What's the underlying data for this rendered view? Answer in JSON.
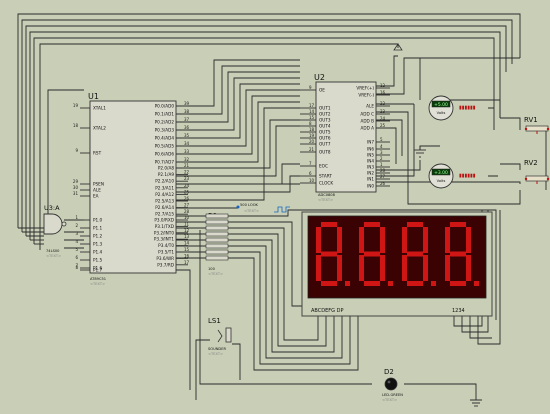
{
  "u1": {
    "ref": "U1",
    "part": "AT89C51",
    "text_hint": "<TEXT>",
    "left_pins": [
      "XTAL1",
      "XTAL2",
      "RST",
      "PSEN",
      "ALE",
      "EA",
      "P1.0",
      "P1.1",
      "P1.2",
      "P1.3",
      "P1.4",
      "P1.5",
      "P1.6",
      "P1.7"
    ],
    "left_pin_nums": [
      "19",
      "18",
      "9",
      "29",
      "30",
      "31",
      "1",
      "2",
      "3",
      "4",
      "5",
      "6",
      "7",
      "8"
    ],
    "right_pins": [
      "P0.0/AD0",
      "P0.1/AD1",
      "P0.2/AD2",
      "P0.3/AD3",
      "P0.4/AD4",
      "P0.5/AD5",
      "P0.6/AD6",
      "P0.7/AD7",
      "P2.0/A8",
      "P2.1/A9",
      "P2.2/A10",
      "P2.3/A11",
      "P2.4/A12",
      "P2.5/A13",
      "P2.6/A14",
      "P2.7/A15",
      "P3.0/RXD",
      "P3.1/TXD",
      "P3.2/INT0",
      "P3.3/INT1",
      "P3.4/T0",
      "P3.5/T1",
      "P3.6/WR",
      "P3.7/RD"
    ],
    "right_pin_nums": [
      "39",
      "38",
      "37",
      "36",
      "35",
      "34",
      "33",
      "32",
      "21",
      "22",
      "23",
      "24",
      "25",
      "26",
      "27",
      "28",
      "10",
      "11",
      "12",
      "13",
      "14",
      "15",
      "16",
      "17"
    ]
  },
  "u2": {
    "ref": "U2",
    "part": "ADC0808",
    "text_hint": "<TEXT>",
    "left_pins": [
      "OE",
      "OUT1",
      "OUT2",
      "OUT3",
      "OUT4",
      "OUT5",
      "OUT6",
      "OUT7",
      "OUT8",
      "EOC",
      "START",
      "CLOCK"
    ],
    "left_pin_nums": [
      "9",
      "17",
      "14",
      "15",
      "8",
      "18",
      "19",
      "20",
      "21",
      "7",
      "6",
      "10"
    ],
    "right_pins": [
      "VREF(+)",
      "VREF(-)",
      "ALE",
      "ADD C",
      "ADD B",
      "ADD A",
      "IN7",
      "IN6",
      "IN5",
      "IN4",
      "IN3",
      "IN2",
      "IN1",
      "IN0"
    ],
    "right_pin_nums": [
      "12",
      "16",
      "22",
      "23",
      "24",
      "25",
      "5",
      "4",
      "3",
      "2",
      "1",
      "28",
      "27",
      "26"
    ]
  },
  "u3": {
    "ref": "U3:A",
    "part": "74LS00",
    "text_hint": "<TEXT>"
  },
  "r1": {
    "ref": "R1",
    "value": "100",
    "text_hint": "<TEXT>"
  },
  "ls1": {
    "ref": "LS1",
    "part": "SOUNDER",
    "text_hint": "<TEXT>"
  },
  "d2": {
    "ref": "D2",
    "part": "LED-GREEN",
    "text_hint": "<TEXT>"
  },
  "rv1": {
    "ref": "RV1"
  },
  "rv2": {
    "ref": "RV2"
  },
  "clock": {
    "label": "500 LOOK",
    "text_hint": "<TEXT>"
  },
  "meter1": {
    "reading": "+5.00",
    "unit": "Volts"
  },
  "meter2": {
    "reading": "+3.00",
    "unit": "Volts"
  },
  "display": {
    "digits": [
      "8",
      "8",
      "8",
      "8"
    ],
    "segments_label": "ABCDEFG DP",
    "digits_label": "1234",
    "digit_color": "#d01515",
    "background": "#3a0202"
  },
  "colors": {
    "background": "#c8cfb6",
    "chip_body": "#d9d9cc",
    "led": "#000000"
  }
}
